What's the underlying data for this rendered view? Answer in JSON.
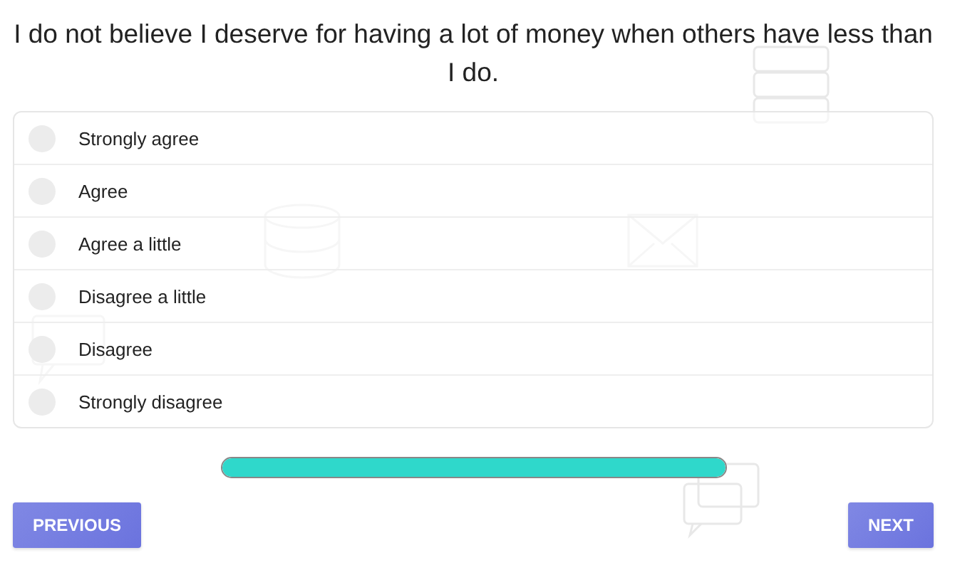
{
  "question": "I do not believe I deserve for having a lot of money when others have less than I do.",
  "options": [
    {
      "label": "Strongly agree",
      "selected": false
    },
    {
      "label": "Agree",
      "selected": false
    },
    {
      "label": "Agree a little",
      "selected": false
    },
    {
      "label": "Disagree a little",
      "selected": false
    },
    {
      "label": "Disagree",
      "selected": false
    },
    {
      "label": "Strongly disagree",
      "selected": false
    }
  ],
  "progress": {
    "level": 1
  },
  "buttons": {
    "previous": "PREVIOUS",
    "next": "NEXT"
  }
}
